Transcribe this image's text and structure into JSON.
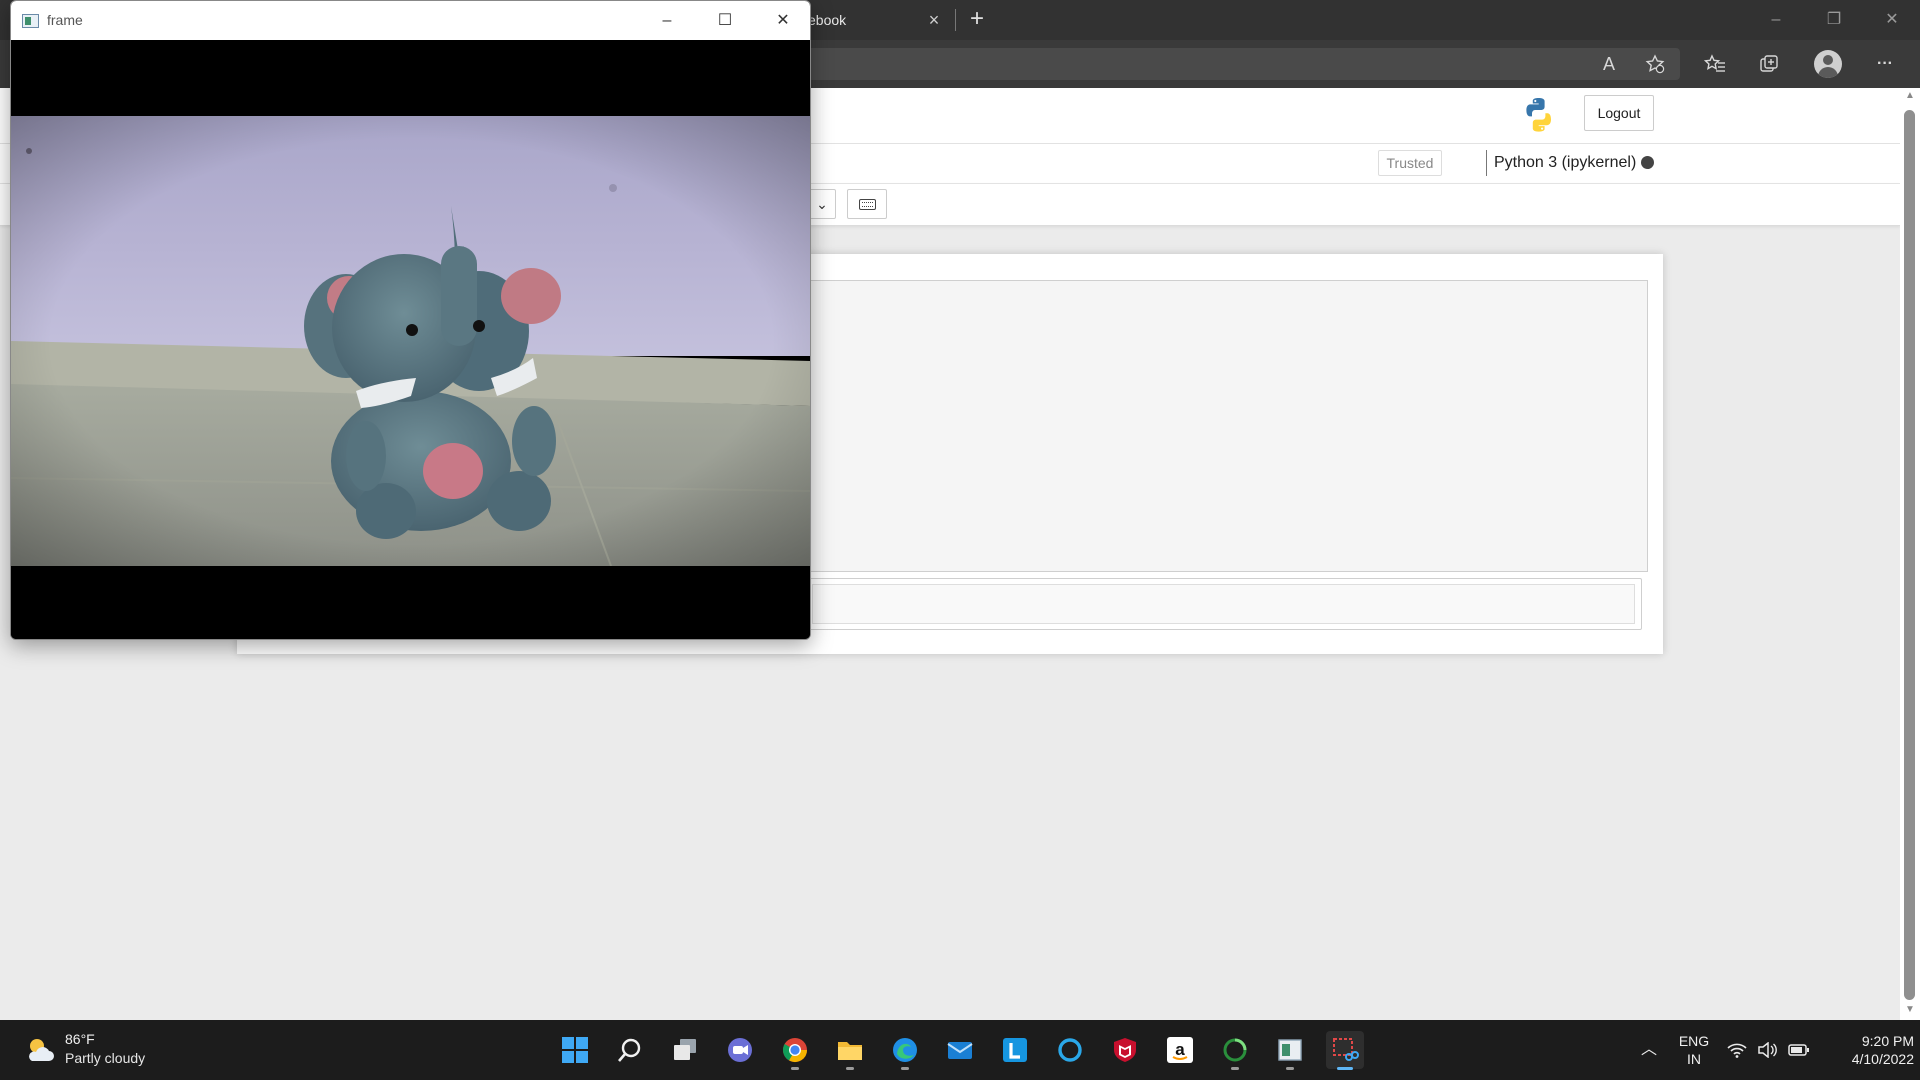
{
  "browser": {
    "tab_title": "ebook",
    "tab_close": "×",
    "new_tab": "+",
    "window_controls": [
      "–",
      "❐",
      "✕"
    ],
    "toolbar_icons": [
      "read-aloud-icon",
      "favorite-add-icon",
      "favorites-icon",
      "collections-icon",
      "profile-icon",
      "more-icon"
    ],
    "read_aloud_glyph": "A",
    "more_glyph": "···"
  },
  "jupyter": {
    "logout_label": "Logout",
    "trusted_label": "Trusted",
    "kernel_label": "Python 3 (ipykernel)",
    "celltype_chevron": "⌄"
  },
  "frame_window": {
    "title": "frame",
    "controls": [
      "–",
      "☐",
      "✕"
    ]
  },
  "taskbar": {
    "weather_temp": "86°F",
    "weather_desc": "Partly cloudy",
    "apps": [
      "start",
      "search",
      "task-view",
      "teams-chat",
      "chrome",
      "file-explorer",
      "edge",
      "mail",
      "l-app",
      "cortana",
      "mcafee",
      "amazon",
      "loading-app",
      "notebook-app",
      "snipping-tool"
    ],
    "active_app": "snipping-tool",
    "lang_line1": "ENG",
    "lang_line2": "IN",
    "time": "9:20 PM",
    "date": "4/10/2022"
  },
  "colors": {
    "taskbar_bg": "#1c1c1c",
    "browser_tabbar": "#323232",
    "accent_blue": "#5fb6f5",
    "kernel_idle": "#444444"
  }
}
